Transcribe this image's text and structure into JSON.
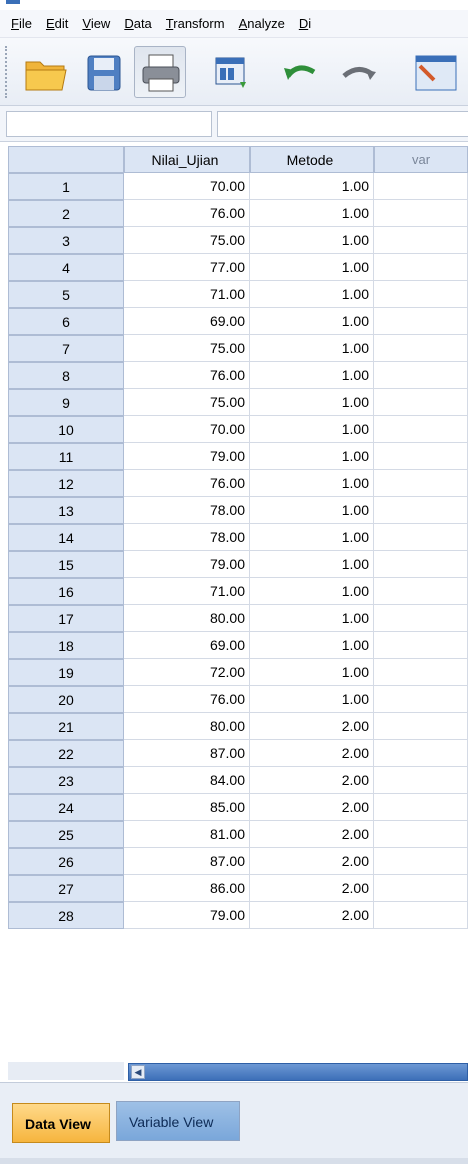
{
  "menu": [
    {
      "label": "File",
      "underline": "F",
      "rest": "ile"
    },
    {
      "label": "Edit",
      "underline": "E",
      "rest": "dit"
    },
    {
      "label": "View",
      "underline": "V",
      "rest": "iew"
    },
    {
      "label": "Data",
      "underline": "D",
      "rest": "ata"
    },
    {
      "label": "Transform",
      "underline": "T",
      "rest": "ransform"
    },
    {
      "label": "Analyze",
      "underline": "A",
      "rest": "nalyze"
    },
    {
      "label": "Di",
      "underline": "D",
      "rest": "i"
    }
  ],
  "toolbar": {
    "buttons": [
      "open-icon",
      "save-icon",
      "print-icon",
      "dialog-recall-icon",
      "undo-icon",
      "redo-icon",
      "goto-case-icon"
    ]
  },
  "cellbar": {
    "name": "",
    "value": ""
  },
  "columns": [
    "",
    "Nilai_Ujian",
    "Metode",
    "var"
  ],
  "rows": [
    [
      "1",
      "70.00",
      "1.00"
    ],
    [
      "2",
      "76.00",
      "1.00"
    ],
    [
      "3",
      "75.00",
      "1.00"
    ],
    [
      "4",
      "77.00",
      "1.00"
    ],
    [
      "5",
      "71.00",
      "1.00"
    ],
    [
      "6",
      "69.00",
      "1.00"
    ],
    [
      "7",
      "75.00",
      "1.00"
    ],
    [
      "8",
      "76.00",
      "1.00"
    ],
    [
      "9",
      "75.00",
      "1.00"
    ],
    [
      "10",
      "70.00",
      "1.00"
    ],
    [
      "11",
      "79.00",
      "1.00"
    ],
    [
      "12",
      "76.00",
      "1.00"
    ],
    [
      "13",
      "78.00",
      "1.00"
    ],
    [
      "14",
      "78.00",
      "1.00"
    ],
    [
      "15",
      "79.00",
      "1.00"
    ],
    [
      "16",
      "71.00",
      "1.00"
    ],
    [
      "17",
      "80.00",
      "1.00"
    ],
    [
      "18",
      "69.00",
      "1.00"
    ],
    [
      "19",
      "72.00",
      "1.00"
    ],
    [
      "20",
      "76.00",
      "1.00"
    ],
    [
      "21",
      "80.00",
      "2.00"
    ],
    [
      "22",
      "87.00",
      "2.00"
    ],
    [
      "23",
      "84.00",
      "2.00"
    ],
    [
      "24",
      "85.00",
      "2.00"
    ],
    [
      "25",
      "81.00",
      "2.00"
    ],
    [
      "26",
      "87.00",
      "2.00"
    ],
    [
      "27",
      "86.00",
      "2.00"
    ],
    [
      "28",
      "79.00",
      "2.00"
    ]
  ],
  "tabs": {
    "data_view": "Data View",
    "variable_view": "Variable View"
  },
  "colors": {
    "accent_tab": "#f6b53e",
    "header_bg": "#dbe5f4",
    "scroll": "#3c6fb8"
  }
}
